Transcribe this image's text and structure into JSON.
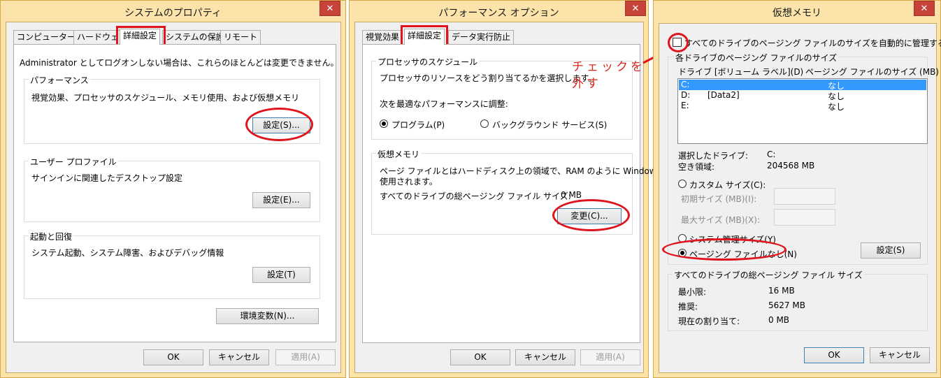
{
  "dialog1": {
    "title": "システムのプロパティ",
    "close": "✕",
    "tabs": [
      "コンピューター名",
      "ハードウェア",
      "詳細設定",
      "システムの保護",
      "リモート"
    ],
    "admin_note": "Administrator としてログオンしない場合は、これらのほとんどは変更できません。",
    "performance": {
      "label": "パフォーマンス",
      "desc": "視覚効果、プロセッサのスケジュール、メモリ使用、および仮想メモリ",
      "button": "設定(S)..."
    },
    "user_profile": {
      "label": "ユーザー プロファイル",
      "desc": "サインインに関連したデスクトップ設定",
      "button": "設定(E)..."
    },
    "startup": {
      "label": "起動と回復",
      "desc": "システム起動、システム障害、およびデバッグ情報",
      "button": "設定(T)"
    },
    "env_button": "環境変数(N)...",
    "ok": "OK",
    "cancel": "キャンセル",
    "apply": "適用(A)"
  },
  "dialog2": {
    "title": "パフォーマンス オプション",
    "close": "✕",
    "tabs": [
      "視覚効果",
      "詳細設定",
      "データ実行防止"
    ],
    "scheduling": {
      "label": "プロセッサのスケジュール",
      "desc": "プロセッサのリソースをどう割り当てるかを選択します。",
      "adjust": "次を最適なパフォーマンスに調整:",
      "programs": "プログラム(P)",
      "background": "バックグラウンド サービス(S)"
    },
    "vm": {
      "label": "仮想メモリ",
      "desc1": "ページ ファイルとはハードディスク上の領域で、RAM のように Windows で",
      "desc2": "使用されます。",
      "total_label": "すべてのドライブの総ページング ファイル サイズ:",
      "total_value": "0 MB",
      "change": "変更(C)..."
    },
    "ok": "OK",
    "cancel": "キャンセル",
    "apply": "適用(A)"
  },
  "annotation": {
    "line1": "チェックを",
    "line2": "外す"
  },
  "dialog3": {
    "title": "仮想メモリ",
    "close": "✕",
    "auto_manage": "すべてのドライブのページング ファイルのサイズを自動的に管理する(A)",
    "group_label": "各ドライブのページング ファイルのサイズ",
    "col_drive": "ドライブ [ボリューム ラベル](D)",
    "col_size": "ページング ファイルのサイズ (MB)",
    "drives": [
      {
        "drive": "C:",
        "label": "",
        "size": "なし"
      },
      {
        "drive": "D:",
        "label": "[Data2]",
        "size": "なし"
      },
      {
        "drive": "E:",
        "label": "",
        "size": "なし"
      }
    ],
    "selected_drive_label": "選択したドライブ:",
    "selected_drive_value": "C:",
    "free_space_label": "空き領域:",
    "free_space_value": "204568 MB",
    "custom_size": "カスタム サイズ(C):",
    "initial_size": "初期サイズ (MB)(I):",
    "max_size": "最大サイズ (MB)(X):",
    "system_managed": "システム管理サイズ(Y)",
    "no_paging": "ページング ファイルなし(N)",
    "set_button": "設定(S)",
    "totals_label": "すべてのドライブの総ページング ファイル サイズ",
    "min_label": "最小限:",
    "min_value": "16 MB",
    "recommended_label": "推奨:",
    "recommended_value": "5627 MB",
    "current_label": "現在の割り当て:",
    "current_value": "0 MB",
    "ok": "OK",
    "cancel": "キャンセル"
  },
  "colors": {
    "frame": "#fbe3a9",
    "close": "#c7433a",
    "highlight": "#e0141c",
    "selection": "#3399ff"
  }
}
